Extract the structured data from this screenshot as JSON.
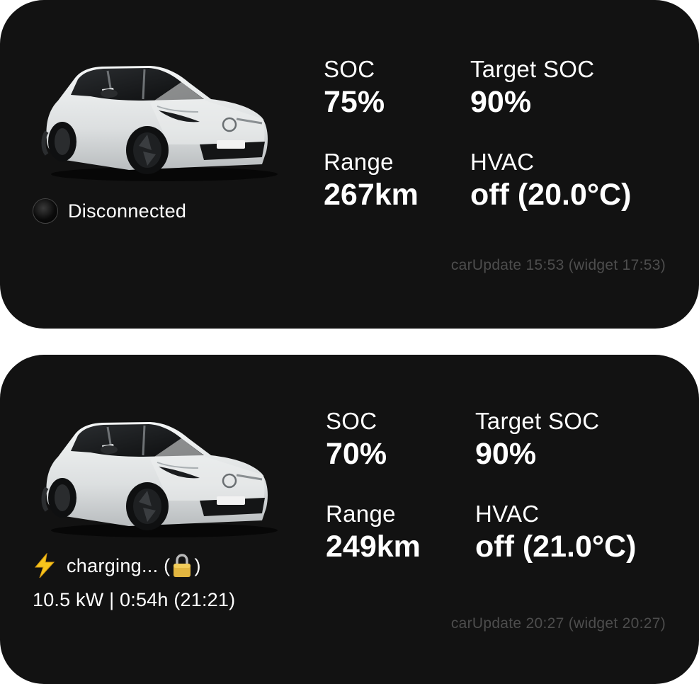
{
  "widgets": [
    {
      "status": {
        "indicator": "dark-circle-icon",
        "text": "Disconnected"
      },
      "metrics": {
        "soc": {
          "label": "SOC",
          "value": "75%"
        },
        "target_soc": {
          "label": "Target SOC",
          "value": "90%"
        },
        "range": {
          "label": "Range",
          "value": "267km"
        },
        "hvac": {
          "label": "HVAC",
          "value": "off (20.0°C)"
        }
      },
      "update_text": "carUpdate 15:53 (widget 17:53)"
    },
    {
      "status": {
        "indicator": "lightning-bolt-icon",
        "text_prefix": "charging... (",
        "lock_icon": "padlock-icon",
        "text_suffix": ")"
      },
      "charging_detail": "10.5 kW | 0:54h (21:21)",
      "metrics": {
        "soc": {
          "label": "SOC",
          "value": "70%"
        },
        "target_soc": {
          "label": "Target SOC",
          "value": "90%"
        },
        "range": {
          "label": "Range",
          "value": "249km"
        },
        "hvac": {
          "label": "HVAC",
          "value": "off (21.0°C)"
        }
      },
      "update_text": "carUpdate 20:27 (widget 20:27)"
    }
  ],
  "colors": {
    "widget_background": "#121212",
    "page_background": "#ffffff",
    "text_primary": "#ffffff",
    "text_muted": "#4d4d4d",
    "bolt_yellow": "#f7c51c"
  }
}
